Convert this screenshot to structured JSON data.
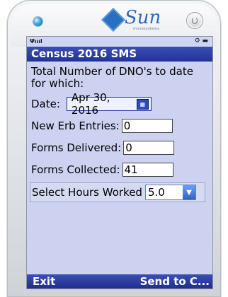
{
  "device": {
    "brand": "Sun",
    "brand_sub": "microsystems"
  },
  "statusbar": {
    "signal": "Ψıııl",
    "right_icons": "⚙ ▬"
  },
  "app": {
    "title": "Census 2016 SMS"
  },
  "form": {
    "intro": "Total Number of DNO's to date for which:",
    "date_label": "Date:",
    "date_value": "Apr 30, 2016",
    "new_erb_label": "New Erb Entries:",
    "new_erb_value": "0",
    "delivered_label": "Forms Delivered:",
    "delivered_value": "0",
    "collected_label": "Forms Collected:",
    "collected_value": "41",
    "hours_label": "Select Hours Worked",
    "hours_value": "5.0"
  },
  "softkeys": {
    "left": "Exit",
    "right": "Send to C..."
  },
  "colors": {
    "title_bg": "#2a3aa5",
    "screen_bg": "#ccd2f0",
    "accent": "#3b4eb3"
  }
}
